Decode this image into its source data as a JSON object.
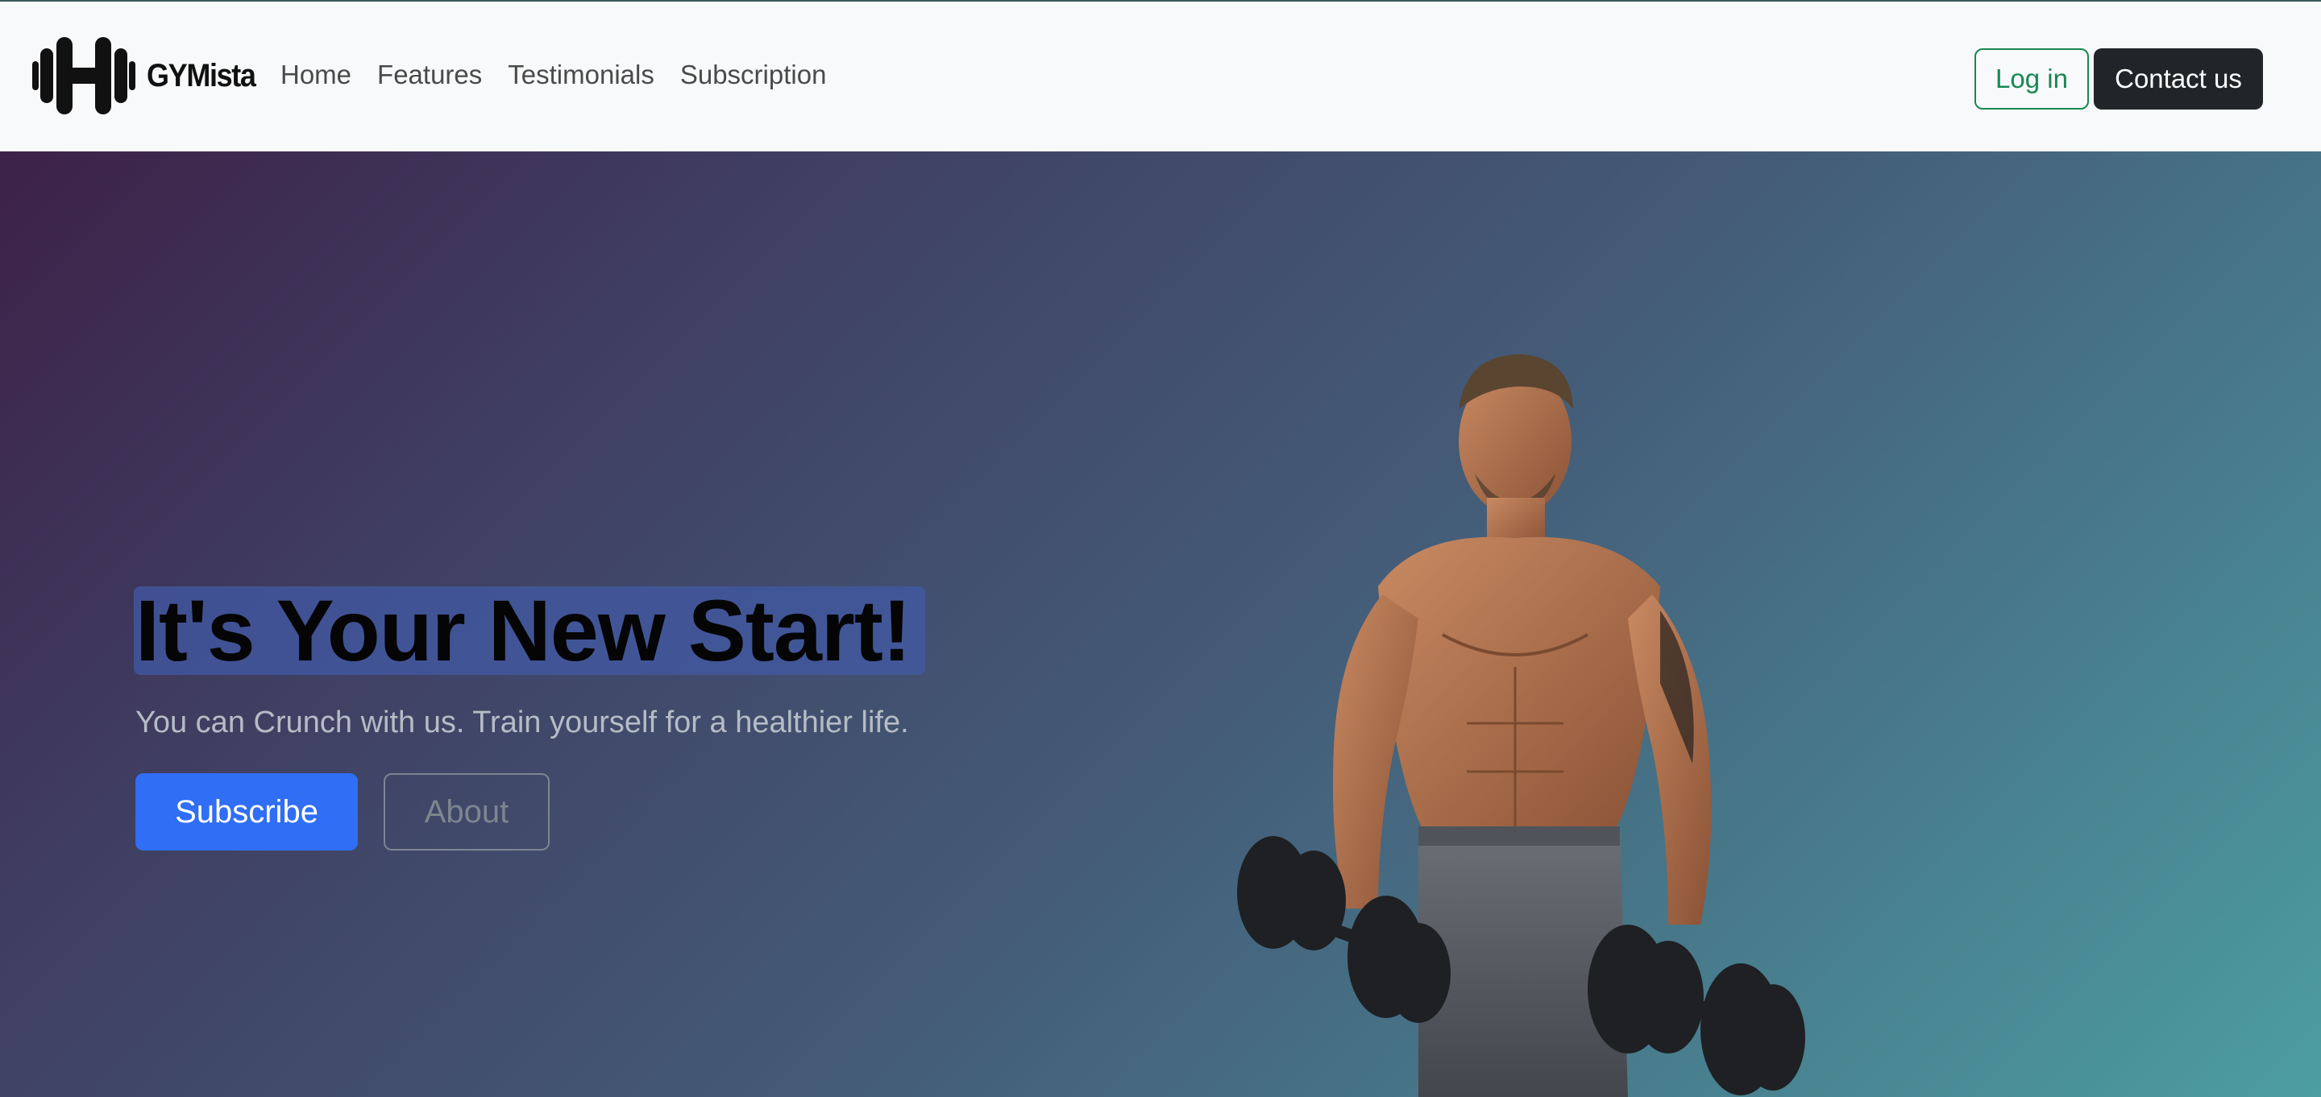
{
  "navbar": {
    "brand_name": "GYMista",
    "links": [
      "Home",
      "Features",
      "Testimonials",
      "Subscription"
    ],
    "login_label": "Log in",
    "contact_label": "Contact us"
  },
  "hero": {
    "title": "It's Your New Start!",
    "subtitle": "You can Crunch with us. Train yourself for a healthier life.",
    "subscribe_label": "Subscribe",
    "about_label": "About"
  },
  "colors": {
    "login_border": "#198754",
    "contact_bg": "#212529",
    "subscribe_bg": "#2f6ef5",
    "hero_gradient_start": "#3d2148",
    "hero_gradient_end": "#4c9ea2"
  },
  "icons": {
    "logo": "dumbbell-h-logo-icon"
  }
}
